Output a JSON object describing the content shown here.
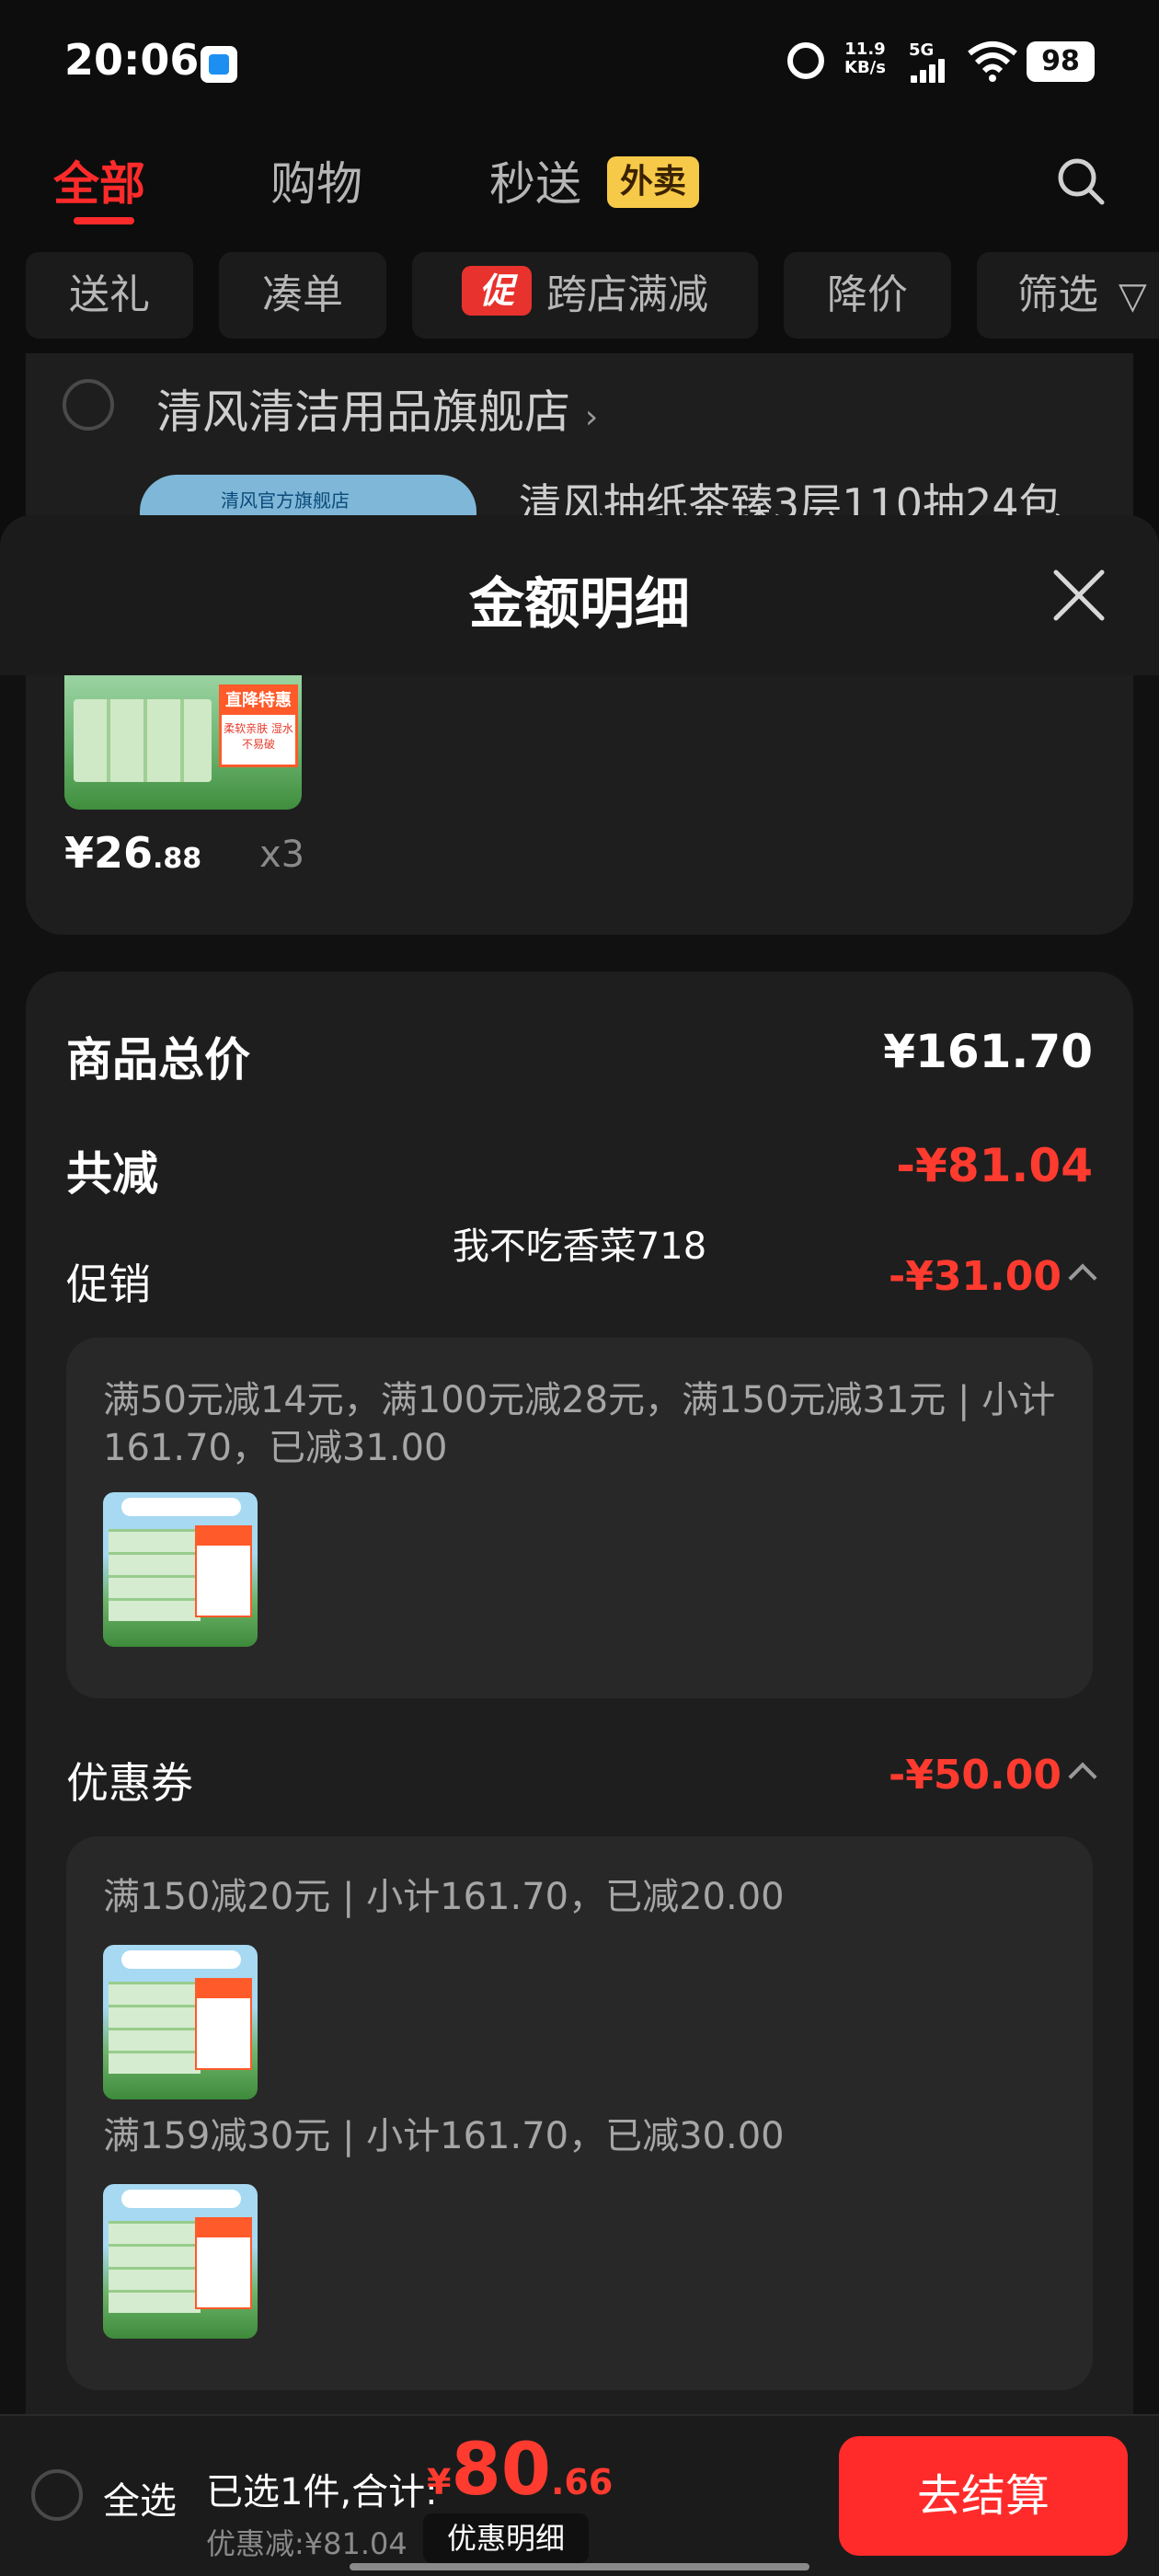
{
  "status_bar": {
    "time": "20:06",
    "net_speed_value": "11.9",
    "net_speed_unit": "KB/s",
    "network": "5G",
    "battery": "98"
  },
  "tabs": [
    {
      "label": "全部",
      "active": true
    },
    {
      "label": "购物",
      "active": false
    },
    {
      "label": "秒送",
      "active": false,
      "badge": "外卖"
    }
  ],
  "filters": [
    {
      "label": "送礼"
    },
    {
      "label": "凑单"
    },
    {
      "label": "跨店满减",
      "tag": "促"
    },
    {
      "label": "降价"
    },
    {
      "label": "筛选"
    }
  ],
  "store": {
    "name": "清风清洁用品旗舰店",
    "thumb_label": "清风官方旗舰店",
    "product_title": "清风抽纸茶臻3层110抽24包"
  },
  "sheet": {
    "title": "金额明细"
  },
  "item": {
    "price_int": "¥26",
    "price_dec": ".88",
    "qty": "x3",
    "thumb_tag": "直降特惠",
    "thumb_sub": "柔软亲肤 湿水不易破"
  },
  "summary": {
    "total_label": "商品总价",
    "total_value": "¥161.70",
    "reduce_label": "共减",
    "reduce_value": "-¥81.04",
    "promo_label": "促销",
    "promo_value": "-¥31.00",
    "promo_detail": "满50元减14元，满100元减28元，满150元减31元 | 小计161.70，已减31.00",
    "coupon_label": "优惠券",
    "coupon_value": "-¥50.00",
    "coupons": [
      {
        "text": "满150减20元 | 小计161.70，已减20.00"
      },
      {
        "text": "满159减30元 | 小计161.70，已减30.00"
      }
    ]
  },
  "watermark": "我不吃香菜718",
  "bottom": {
    "select_all": "全选",
    "selected": "已选1件,合计:",
    "currency": "¥",
    "price_int": "80",
    "price_dec": ".66",
    "discount": "优惠减:¥81.04",
    "detail_link": "优惠明细",
    "checkout": "去结算"
  },
  "colors": {
    "accent_red": "#ff2b2b",
    "price_red": "#ff3b30",
    "badge_yellow": "#f7c948",
    "background": "#0d0d0d"
  }
}
